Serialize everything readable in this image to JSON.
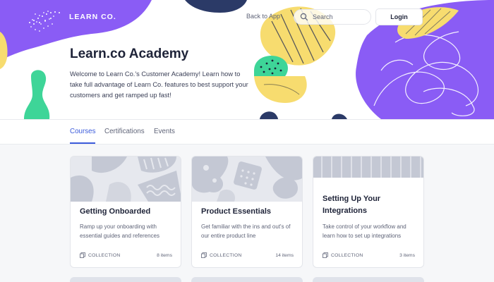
{
  "header": {
    "brand_name": "LEARN CO.",
    "back_link": "Back to App",
    "search_placeholder": "Search",
    "login_label": "Login"
  },
  "hero": {
    "title": "Learn.co Academy",
    "description": "Welcome to Learn Co.'s Customer Academy! Learn how to take full advantage of Learn Co. features to best support your customers and get ramped up fast!"
  },
  "tabs": [
    {
      "label": "Courses",
      "active": true
    },
    {
      "label": "Certifications",
      "active": false
    },
    {
      "label": "Events",
      "active": false
    }
  ],
  "cards": [
    {
      "title": "Getting Onboarded",
      "description": "Ramp up your onboarding with essential guides and references",
      "type_label": "COLLECTION",
      "count": "8 items"
    },
    {
      "title": "Product Essentials",
      "description": "Get familiar with the ins and out's of our entire product line",
      "type_label": "COLLECTION",
      "count": "14 items"
    },
    {
      "title": "Setting Up Your Integrations",
      "description": "Take control of your workflow and learn how to set up integrations",
      "type_label": "COLLECTION",
      "count": "3 items"
    }
  ],
  "colors": {
    "accent": "#3b5bdb",
    "purple": "#8a5cf5",
    "yellow": "#f7dc6f",
    "green": "#3ed598",
    "navy": "#2b3a67"
  }
}
